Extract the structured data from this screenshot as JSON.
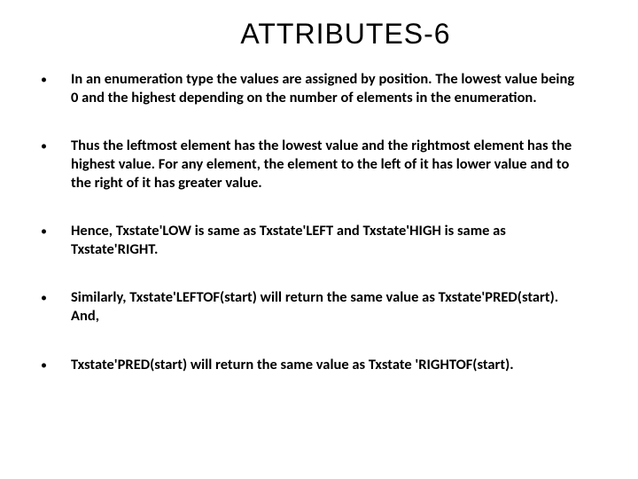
{
  "title": "ATTRIBUTES-6",
  "bullets": [
    {
      "text": "In an enumeration type the values are assigned by  position. The lowest value being 0 and the highest depending on the number of elements in the enumeration."
    },
    {
      "text": "Thus the leftmost element has the lowest value and the rightmost element has the highest value.  For any element, the element to the left of it has lower value and to the right of it has greater value."
    },
    {
      "text": "Hence, Txstate'LOW is same as Txstate'LEFT and Txstate'HIGH is same as Txstate'RIGHT."
    },
    {
      "text": "Similarly, Txstate'LEFTOF(start) will return the same  value as Txstate'PRED(start). And,"
    },
    {
      "text": "Txstate'PRED(start)  will return the same value as Txstate 'RIGHTOF(start)."
    }
  ]
}
